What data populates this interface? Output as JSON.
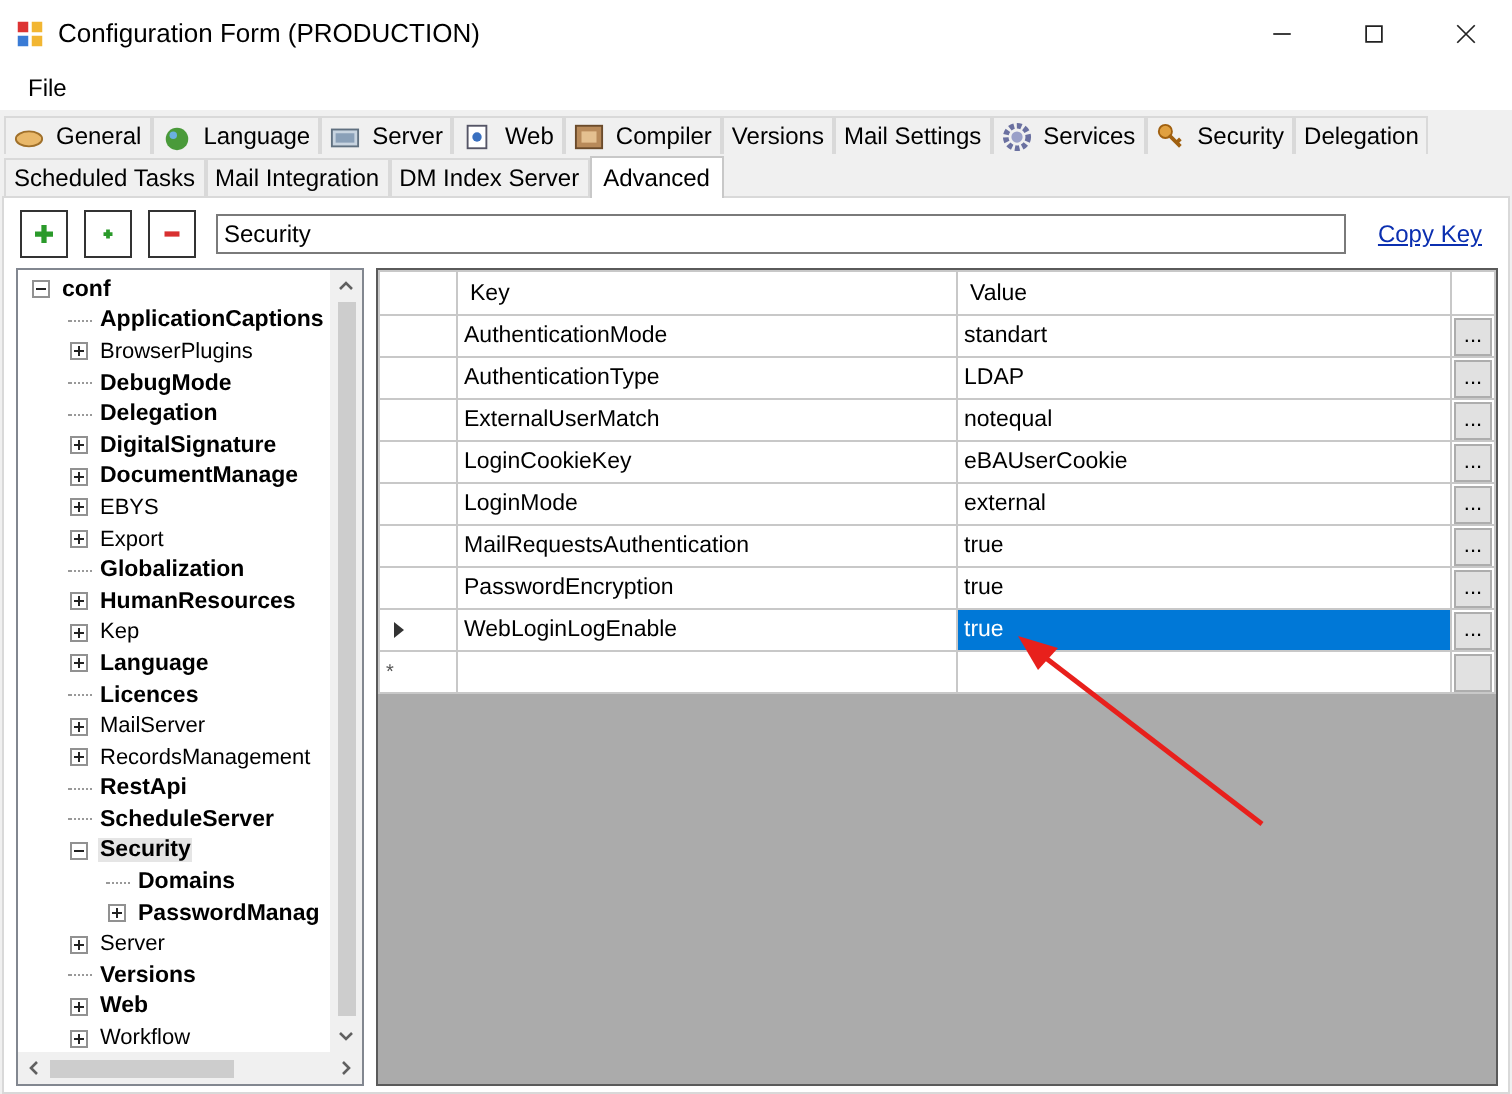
{
  "window": {
    "title": "Configuration Form (PRODUCTION)"
  },
  "menu": [
    "File"
  ],
  "tab_rows": [
    [
      {
        "label": "General",
        "icon": true,
        "selected": false
      },
      {
        "label": "Language",
        "icon": true,
        "selected": false
      },
      {
        "label": "Server",
        "icon": true,
        "selected": false
      },
      {
        "label": "Web",
        "icon": true,
        "selected": false
      },
      {
        "label": "Compiler",
        "icon": true,
        "selected": false
      },
      {
        "label": "Versions",
        "icon": false,
        "selected": false
      },
      {
        "label": "Mail Settings",
        "icon": false,
        "selected": false
      },
      {
        "label": "Services",
        "icon": true,
        "selected": false
      },
      {
        "label": "Security",
        "icon": true,
        "selected": false
      },
      {
        "label": "Delegation",
        "icon": false,
        "selected": false
      }
    ],
    [
      {
        "label": "Scheduled Tasks",
        "icon": false,
        "selected": false
      },
      {
        "label": "Mail Integration",
        "icon": false,
        "selected": false
      },
      {
        "label": "DM Index Server",
        "icon": false,
        "selected": false
      },
      {
        "label": "Advanced",
        "icon": false,
        "selected": true
      }
    ]
  ],
  "toolbar": {
    "buttons": [
      {
        "kind": "add"
      },
      {
        "kind": "add-small"
      },
      {
        "kind": "remove"
      }
    ],
    "path_field": {
      "value": "Security"
    },
    "link": "Copy Key"
  },
  "tree": [
    {
      "label": "conf",
      "bold": true,
      "expanded": true,
      "selected": false,
      "children": [
        {
          "label": "ApplicationCaptions",
          "bold": true,
          "selected": false
        },
        {
          "label": "BrowserPlugins",
          "bold": false,
          "expanded": false,
          "selected": false
        },
        {
          "label": "DebugMode",
          "bold": true,
          "selected": false
        },
        {
          "label": "Delegation",
          "bold": true,
          "selected": false
        },
        {
          "label": "DigitalSignature",
          "bold": true,
          "expanded": false,
          "selected": false
        },
        {
          "label": "DocumentManage",
          "bold": true,
          "expanded": false,
          "selected": false
        },
        {
          "label": "EBYS",
          "bold": false,
          "expanded": false,
          "selected": false
        },
        {
          "label": "Export",
          "bold": false,
          "expanded": false,
          "selected": false
        },
        {
          "label": "Globalization",
          "bold": true,
          "selected": false
        },
        {
          "label": "HumanResources",
          "bold": true,
          "expanded": false,
          "selected": false
        },
        {
          "label": "Kep",
          "bold": false,
          "expanded": false,
          "selected": false
        },
        {
          "label": "Language",
          "bold": true,
          "expanded": false,
          "selected": false
        },
        {
          "label": "Licences",
          "bold": true,
          "selected": false
        },
        {
          "label": "MailServer",
          "bold": false,
          "expanded": false,
          "selected": false
        },
        {
          "label": "RecordsManagement",
          "bold": false,
          "expanded": false,
          "selected": false
        },
        {
          "label": "RestApi",
          "bold": true,
          "selected": false
        },
        {
          "label": "ScheduleServer",
          "bold": true,
          "selected": false
        },
        {
          "label": "Security",
          "bold": true,
          "expanded": true,
          "selected": true,
          "children": [
            {
              "label": "Domains",
              "bold": true,
              "selected": false
            },
            {
              "label": "PasswordManag",
              "bold": true,
              "expanded": false,
              "selected": false
            }
          ]
        },
        {
          "label": "Server",
          "bold": false,
          "expanded": false,
          "selected": false
        },
        {
          "label": "Versions",
          "bold": true,
          "selected": false
        },
        {
          "label": "Web",
          "bold": true,
          "expanded": false,
          "selected": false
        },
        {
          "label": "Workflow",
          "bold": false,
          "expanded": false,
          "selected": false
        }
      ]
    }
  ],
  "grid": {
    "columns": [
      "Key",
      "Value"
    ],
    "rows": [
      {
        "key": "AuthenticationMode",
        "value": "standart",
        "button": "...",
        "selected": false
      },
      {
        "key": "AuthenticationType",
        "value": "LDAP",
        "button": "...",
        "selected": false
      },
      {
        "key": "ExternalUserMatch",
        "value": "notequal",
        "button": "...",
        "selected": false
      },
      {
        "key": "LoginCookieKey",
        "value": "eBAUserCookie",
        "button": "...",
        "selected": false
      },
      {
        "key": "LoginMode",
        "value": "external",
        "button": "...",
        "selected": false
      },
      {
        "key": "MailRequestsAuthentication",
        "value": "true",
        "button": "...",
        "selected": false
      },
      {
        "key": "PasswordEncryption",
        "value": "true",
        "button": "...",
        "selected": false
      },
      {
        "key": "WebLoginLogEnable",
        "value": "true",
        "button": "...",
        "selected": true
      }
    ],
    "new_row_marker": "*"
  }
}
